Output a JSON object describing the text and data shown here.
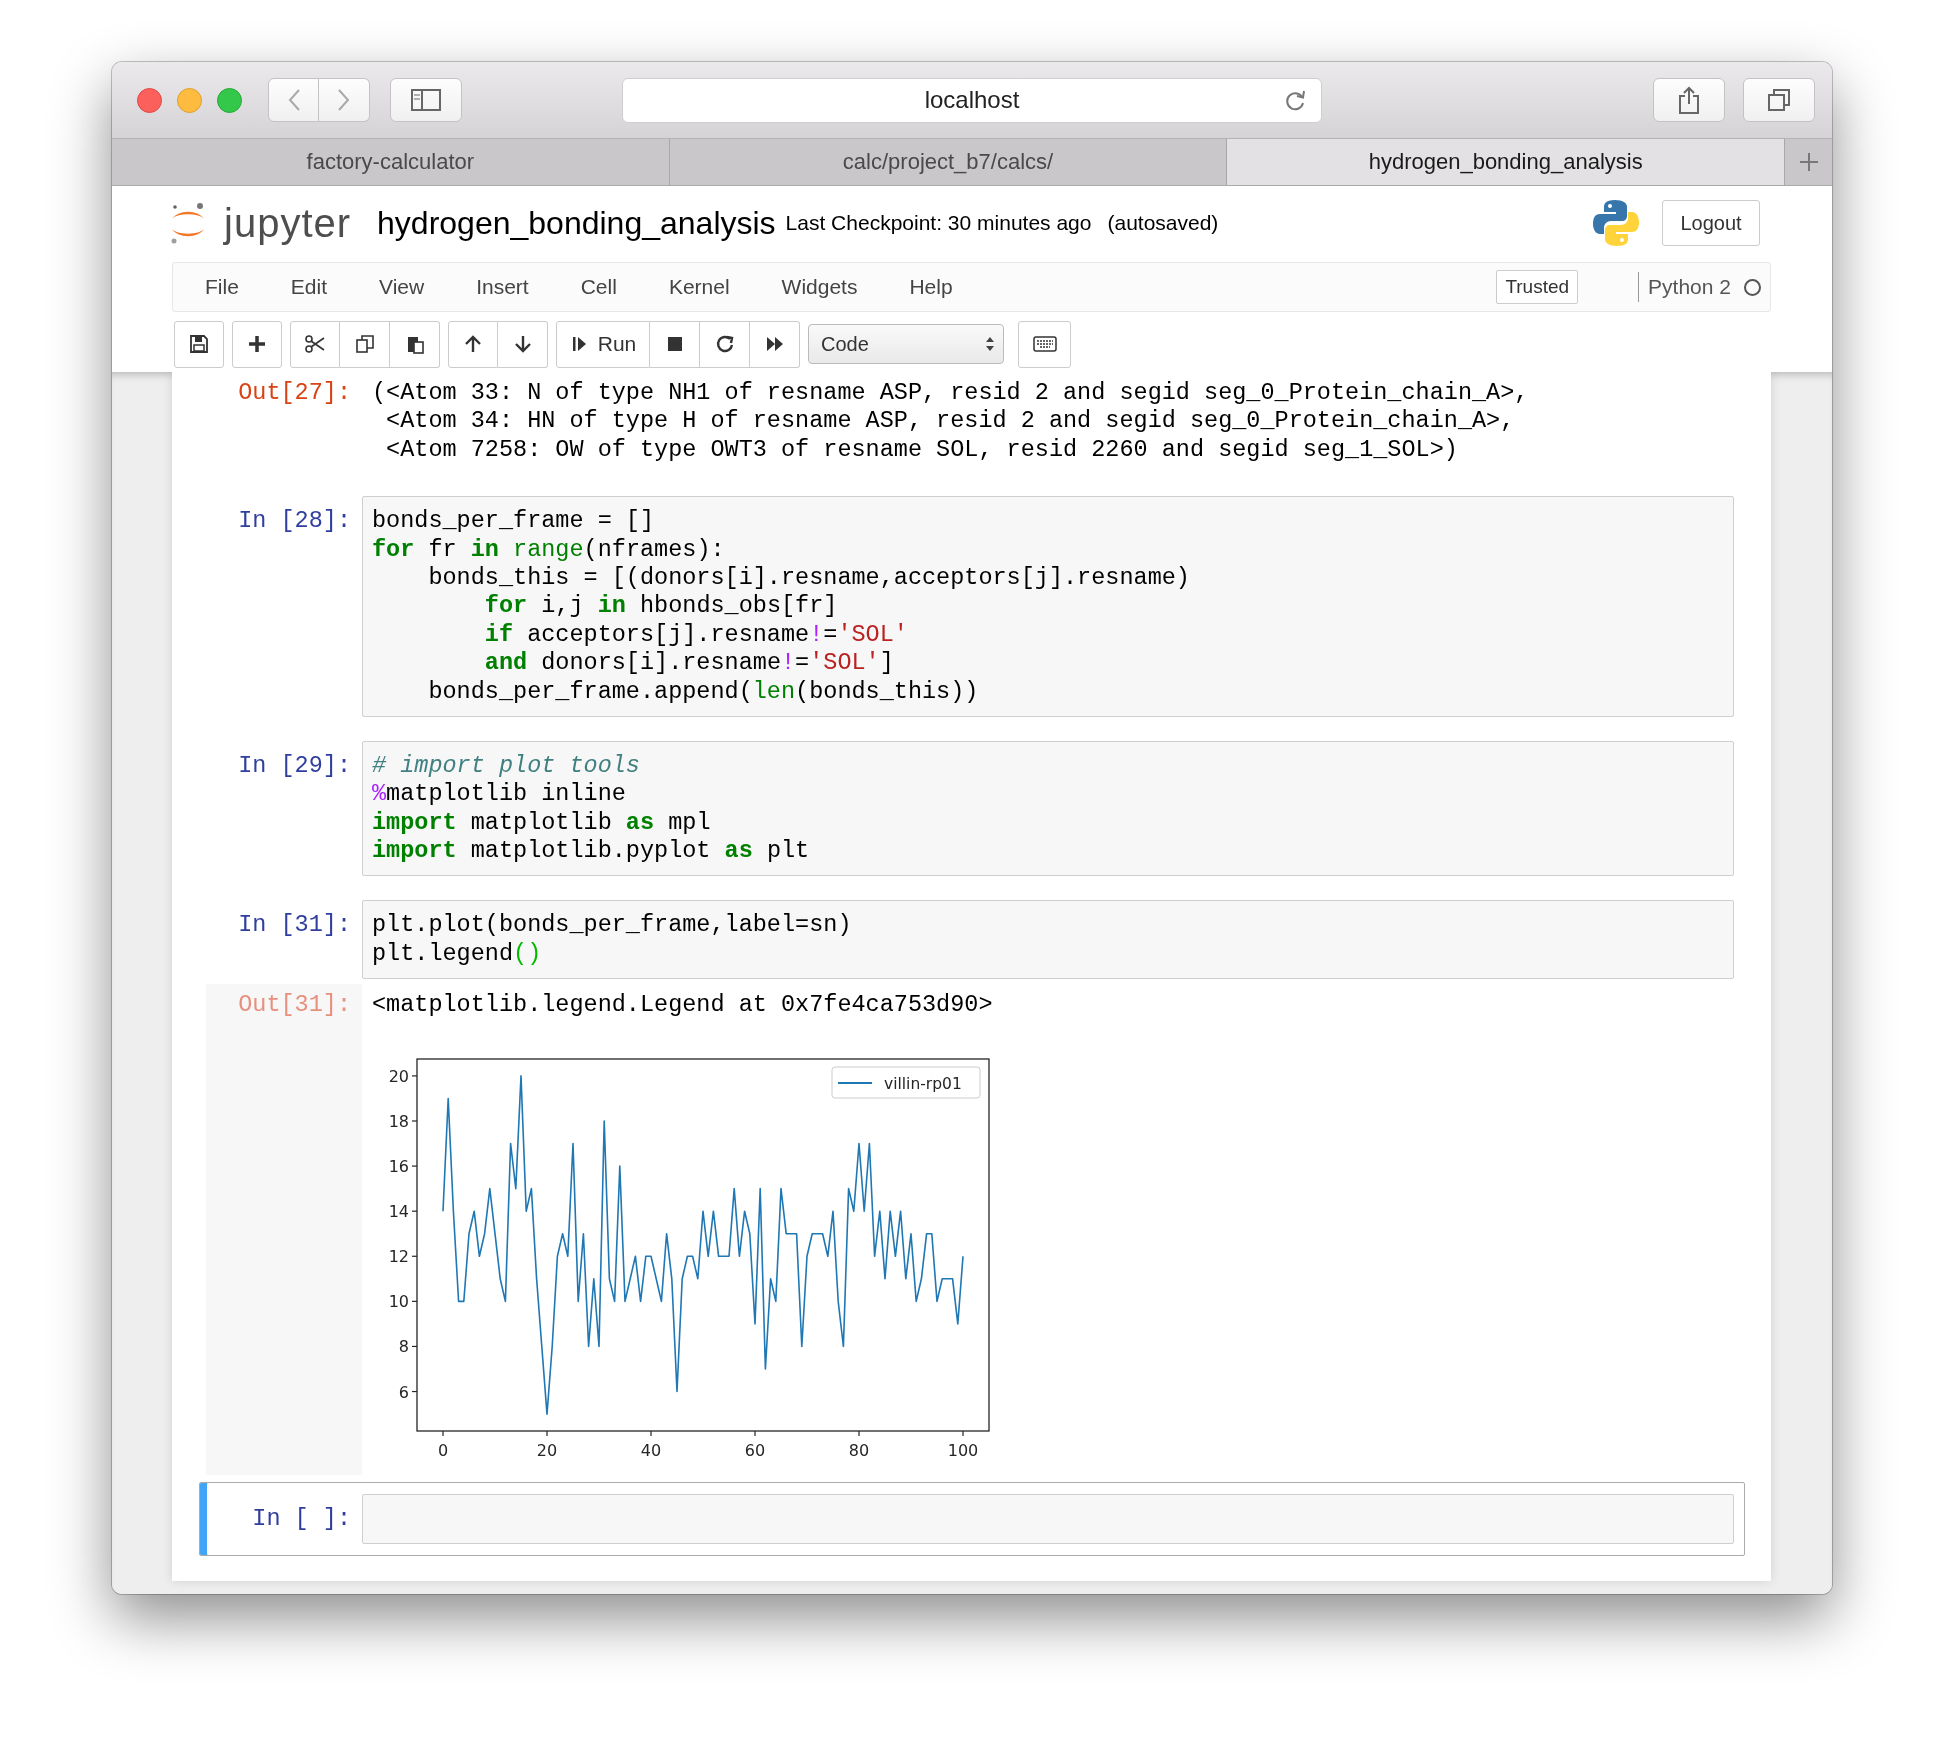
{
  "browser": {
    "address": "localhost",
    "tabs": [
      {
        "label": "factory-calculator",
        "selected": false
      },
      {
        "label": "calc/project_b7/calcs/",
        "selected": false
      },
      {
        "label": "hydrogen_bonding_analysis",
        "selected": true
      }
    ]
  },
  "notebook_header": {
    "logo_text": "jupyter",
    "title": "hydrogen_bonding_analysis",
    "checkpoint": "Last Checkpoint: 30 minutes ago",
    "autosave": "(autosaved)",
    "logout": "Logout"
  },
  "menu": {
    "items": [
      "File",
      "Edit",
      "View",
      "Insert",
      "Cell",
      "Kernel",
      "Widgets",
      "Help"
    ],
    "trusted": "Trusted",
    "kernel": "Python 2",
    "kernel_busy": false
  },
  "toolbar": {
    "run_label": "Run",
    "cell_type": "Code"
  },
  "cells": [
    {
      "selected": false,
      "output": {
        "prompt": "Out[27]:",
        "highlighted": false,
        "lines": [
          "(<Atom 33: N of type NH1 of resname ASP, resid 2 and segid seg_0_Protein_chain_A>,",
          " <Atom 34: HN of type H of resname ASP, resid 2 and segid seg_0_Protein_chain_A>,",
          " <Atom 7258: OW of type OWT3 of resname SOL, resid 2260 and segid seg_1_SOL>)"
        ]
      }
    },
    {
      "selected": false,
      "input": {
        "prompt": "In [28]:",
        "lines": [
          [
            {
              "text": "bonds_per_frame = []",
              "kind": "plain"
            }
          ],
          [
            {
              "text": "for",
              "kind": "keyword"
            },
            {
              "text": " fr ",
              "kind": "plain"
            },
            {
              "text": "in",
              "kind": "keyword"
            },
            {
              "text": " range",
              "kind": "builtin"
            },
            {
              "text": "(nframes):",
              "kind": "plain"
            }
          ],
          [
            {
              "text": "    bonds_this = [(donors[i].resname,acceptors[j].resname)",
              "kind": "plain"
            }
          ],
          [
            {
              "text": "        for",
              "kind": "keyword"
            },
            {
              "text": " i,j ",
              "kind": "plain"
            },
            {
              "text": "in",
              "kind": "keyword"
            },
            {
              "text": " hbonds_obs[fr]",
              "kind": "plain"
            }
          ],
          [
            {
              "text": "        if",
              "kind": "keyword"
            },
            {
              "text": " acceptors[j].resname",
              "kind": "plain"
            },
            {
              "text": "!",
              "kind": "operator"
            },
            {
              "text": "=",
              "kind": "plain"
            },
            {
              "text": "'SOL'",
              "kind": "string"
            }
          ],
          [
            {
              "text": "        and",
              "kind": "keyword"
            },
            {
              "text": " donors[i].resname",
              "kind": "plain"
            },
            {
              "text": "!",
              "kind": "operator"
            },
            {
              "text": "=",
              "kind": "plain"
            },
            {
              "text": "'SOL'",
              "kind": "string"
            },
            {
              "text": "]",
              "kind": "plain"
            }
          ],
          [
            {
              "text": "    bonds_per_frame.append(",
              "kind": "plain"
            },
            {
              "text": "len",
              "kind": "builtin"
            },
            {
              "text": "(bonds_this))",
              "kind": "plain"
            }
          ]
        ]
      }
    },
    {
      "selected": false,
      "input": {
        "prompt": "In [29]:",
        "lines": [
          [
            {
              "text": "# import plot tools",
              "kind": "comment"
            }
          ],
          [
            {
              "text": "%",
              "kind": "magic"
            },
            {
              "text": "matplotlib inline",
              "kind": "plain"
            }
          ],
          [
            {
              "text": "import",
              "kind": "keyword"
            },
            {
              "text": " matplotlib ",
              "kind": "plain"
            },
            {
              "text": "as",
              "kind": "keyword"
            },
            {
              "text": " mpl",
              "kind": "plain"
            }
          ],
          [
            {
              "text": "import",
              "kind": "keyword"
            },
            {
              "text": " matplotlib.pyplot ",
              "kind": "plain"
            },
            {
              "text": "as",
              "kind": "keyword"
            },
            {
              "text": " plt",
              "kind": "plain"
            }
          ]
        ]
      }
    },
    {
      "selected": false,
      "input": {
        "prompt": "In [31]:",
        "lines": [
          [
            {
              "text": "plt.plot(bonds_per_frame,label=sn)",
              "kind": "plain"
            }
          ],
          [
            {
              "text": "plt.legend",
              "kind": "plain"
            },
            {
              "text": "()",
              "kind": "match"
            }
          ]
        ]
      },
      "output": {
        "prompt": "Out[31]:",
        "highlighted": true,
        "lines": [
          "<matplotlib.legend.Legend at 0x7fe4ca753d90>"
        ],
        "chart_data": {
          "type": "line",
          "x": [
            0,
            1,
            2,
            3,
            4,
            5,
            6,
            7,
            8,
            9,
            10,
            11,
            12,
            13,
            14,
            15,
            16,
            17,
            18,
            19,
            20,
            21,
            22,
            23,
            24,
            25,
            26,
            27,
            28,
            29,
            30,
            31,
            32,
            33,
            34,
            35,
            36,
            37,
            38,
            39,
            40,
            41,
            42,
            43,
            44,
            45,
            46,
            47,
            48,
            49,
            50,
            51,
            52,
            53,
            54,
            55,
            56,
            57,
            58,
            59,
            60,
            61,
            62,
            63,
            64,
            65,
            66,
            67,
            68,
            69,
            70,
            71,
            72,
            73,
            74,
            75,
            76,
            77,
            78,
            79,
            80,
            81,
            82,
            83,
            84,
            85,
            86,
            87,
            88,
            89,
            90,
            91,
            92,
            93,
            94,
            95,
            96,
            97,
            98,
            99,
            100
          ],
          "series": [
            {
              "name": "villin-rp01",
              "color": "#1f77b4",
              "values": [
                14,
                19,
                14,
                10,
                10,
                13,
                14,
                12,
                13,
                15,
                13,
                11,
                10,
                17,
                15,
                20,
                14,
                15,
                11,
                8,
                5,
                8,
                12,
                13,
                12,
                17,
                10,
                13,
                8,
                11,
                8,
                18,
                11,
                10,
                16,
                10,
                11,
                12,
                10,
                12,
                12,
                11,
                10,
                13,
                11,
                6,
                11,
                12,
                12,
                11,
                14,
                12,
                14,
                12,
                12,
                12,
                15,
                12,
                14,
                13,
                9,
                15,
                7,
                11,
                10,
                15,
                13,
                13,
                13,
                8,
                12,
                13,
                13,
                13,
                12,
                14,
                10,
                8,
                15,
                14,
                17,
                14,
                17,
                12,
                14,
                11,
                14,
                12,
                14,
                11,
                13,
                10,
                11,
                13,
                13,
                10,
                11,
                11,
                11,
                9,
                12
              ]
            }
          ],
          "xlim": [
            -5,
            105
          ],
          "ylim": [
            4.25,
            20.75
          ],
          "xticks": [
            0,
            20,
            40,
            60,
            80,
            100
          ],
          "yticks": [
            6,
            8,
            10,
            12,
            14,
            16,
            18,
            20
          ]
        }
      }
    },
    {
      "selected": true,
      "input": {
        "prompt": "In [ ]:"
      }
    }
  ]
}
